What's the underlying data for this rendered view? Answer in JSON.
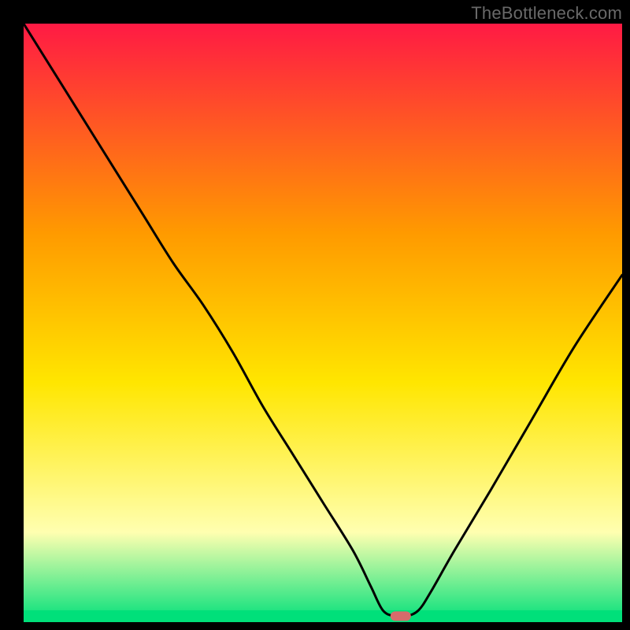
{
  "watermark": "TheBottleneck.com",
  "chart_data": {
    "type": "line",
    "title": "",
    "xlabel": "",
    "ylabel": "",
    "xlim": [
      0,
      100
    ],
    "ylim": [
      0,
      100
    ],
    "background_gradient": {
      "top": "#ff1a44",
      "mid_upper": "#ff9a00",
      "mid": "#ffe600",
      "mid_lower": "#ffffb0",
      "bottom": "#00e07a"
    },
    "marker": {
      "x": 63,
      "y": 1,
      "color": "#d66b6b"
    },
    "series": [
      {
        "name": "curve",
        "color": "#000000",
        "x": [
          0,
          5,
          10,
          15,
          20,
          25,
          30,
          35,
          40,
          45,
          50,
          55,
          58,
          60,
          62,
          64,
          66,
          68,
          72,
          78,
          85,
          92,
          100
        ],
        "values": [
          100,
          92,
          84,
          76,
          68,
          60,
          53,
          45,
          36,
          28,
          20,
          12,
          6,
          2,
          1,
          1,
          2,
          5,
          12,
          22,
          34,
          46,
          58
        ]
      }
    ]
  }
}
